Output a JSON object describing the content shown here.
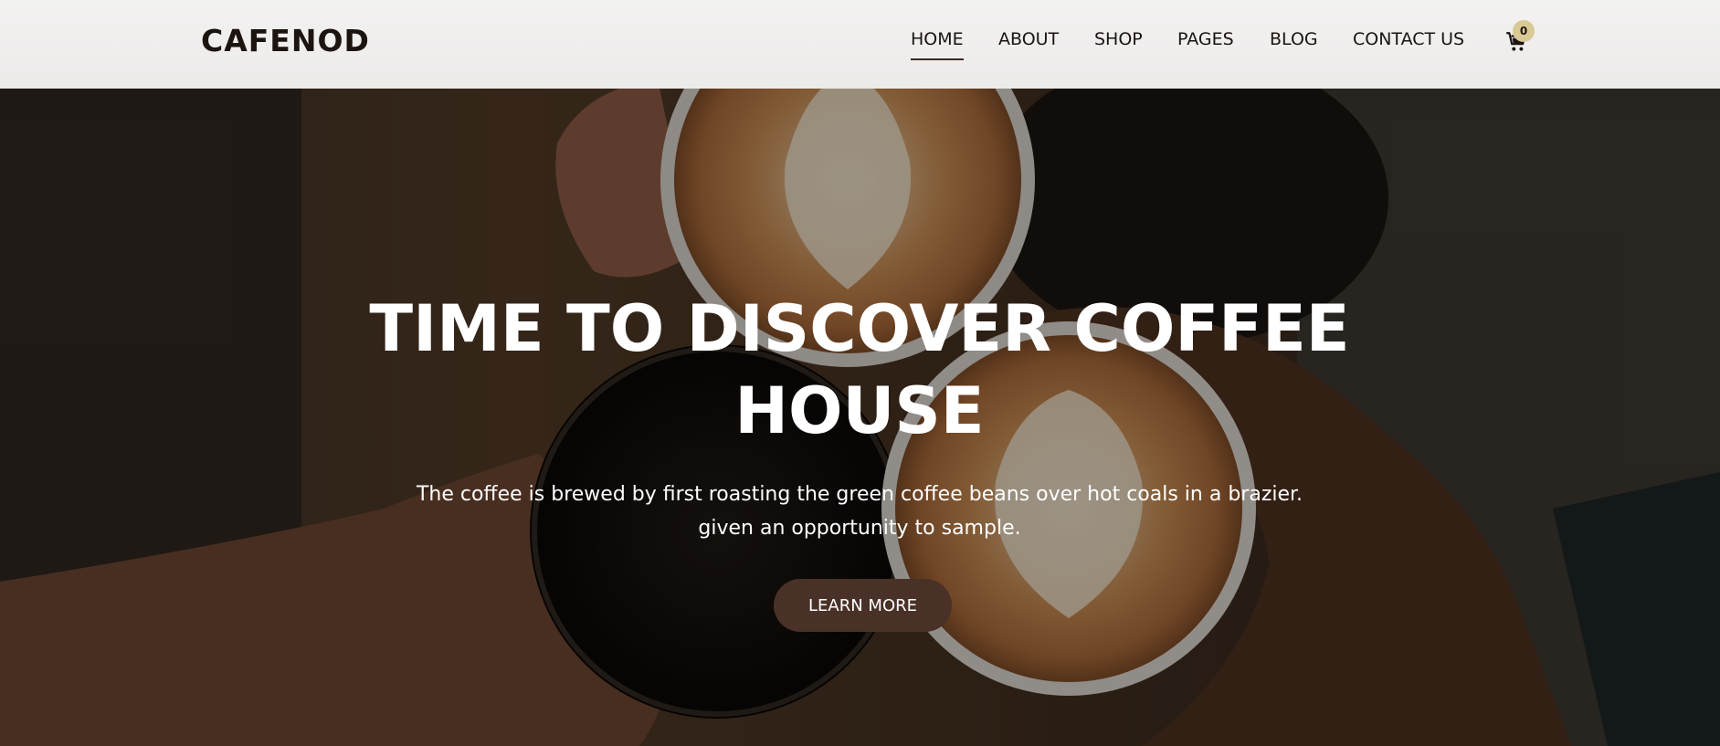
{
  "header": {
    "logo": "CAFENOD",
    "nav": [
      {
        "label": "HOME",
        "active": true
      },
      {
        "label": "ABOUT",
        "active": false
      },
      {
        "label": "SHOP",
        "active": false
      },
      {
        "label": "PAGES",
        "active": false
      },
      {
        "label": "BLOG",
        "active": false
      },
      {
        "label": "CONTACT US",
        "active": false
      }
    ],
    "cart_count": "0",
    "cart_icon": "cart-icon",
    "badge_color": "#d9ca95"
  },
  "hero": {
    "title_line1": "TIME TO DISCOVER COFFEE",
    "title_line2": "HOUSE",
    "text_line1": "The coffee is brewed by first roasting the green coffee beans over hot coals in a brazier.",
    "text_line2": "given an opportunity to sample.",
    "button_label": "LEARN MORE",
    "button_color": "#4a3127",
    "background_image": "hands-toasting-coffee-cups"
  }
}
